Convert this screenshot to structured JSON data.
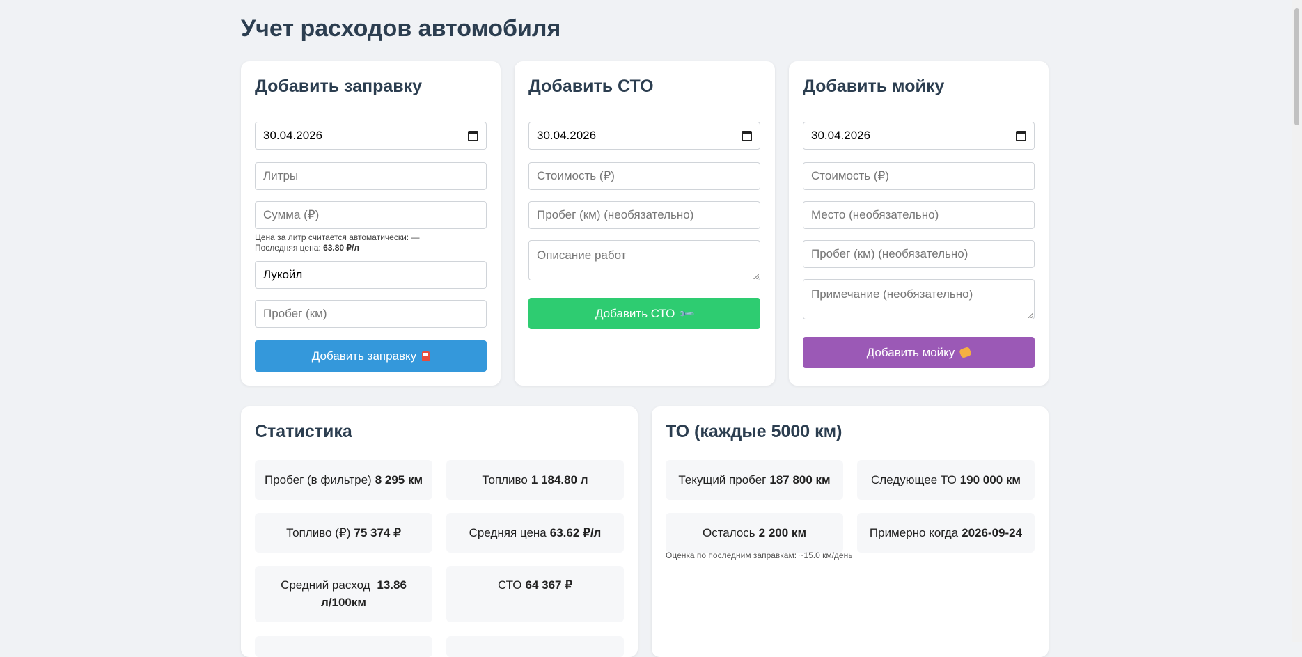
{
  "page": {
    "title": "Учет расходов автомобиля"
  },
  "fuel_form": {
    "heading": "Добавить заправку",
    "date_value": "30.04.2026",
    "liters_placeholder": "Литры",
    "sum_placeholder": "Сумма (₽)",
    "price_hint": "Цена за литр считается автоматически: —",
    "last_price_label": "Последняя цена:",
    "last_price_value": "63.80 ₽/л",
    "station_value": "Лукойл",
    "mileage_placeholder": "Пробег (км)",
    "submit_label": "Добавить заправку",
    "submit_icon": "fuel-pump-icon"
  },
  "service_form": {
    "heading": "Добавить СТО",
    "date_value": "30.04.2026",
    "cost_placeholder": "Стоимость (₽)",
    "mileage_placeholder": "Пробег (км) (необязательно)",
    "description_placeholder": "Описание работ",
    "submit_label": "Добавить СТО",
    "submit_icon": "wrench-icon"
  },
  "wash_form": {
    "heading": "Добавить мойку",
    "date_value": "30.04.2026",
    "cost_placeholder": "Стоимость (₽)",
    "place_placeholder": "Место (необязательно)",
    "mileage_placeholder": "Пробег (км) (необязательно)",
    "note_placeholder": "Примечание (необязательно)",
    "submit_label": "Добавить мойку",
    "submit_icon": "sponge-icon"
  },
  "stats": {
    "heading": "Статистика",
    "items": [
      {
        "label": "Пробег (в фильтре)",
        "value": "8 295 км"
      },
      {
        "label": "Топливо",
        "value": "1 184.80 л"
      },
      {
        "label": "Топливо (₽)",
        "value": "75 374 ₽"
      },
      {
        "label": "Средняя цена",
        "value": "63.62 ₽/л"
      },
      {
        "label": "Средний расход",
        "value": "13.86 л/100км"
      },
      {
        "label": "СТО",
        "value": "64 367 ₽"
      }
    ]
  },
  "maintenance": {
    "heading": "ТО (каждые 5000 км)",
    "items": [
      {
        "label": "Текущий пробег",
        "value": "187 800 км"
      },
      {
        "label": "Следующее ТО",
        "value": "190 000 км"
      },
      {
        "label": "Осталось",
        "value": "2 200 км"
      },
      {
        "label": "Примерно когда",
        "value": "2026-09-24"
      }
    ],
    "estimate_note": "Оценка по последним заправкам: ~15.0 км/день"
  },
  "colors": {
    "fuel_button": "#3498db",
    "service_button": "#2ecc71",
    "wash_button": "#9b59b6",
    "heading": "#2c3e50",
    "background": "#f0f2f5"
  }
}
